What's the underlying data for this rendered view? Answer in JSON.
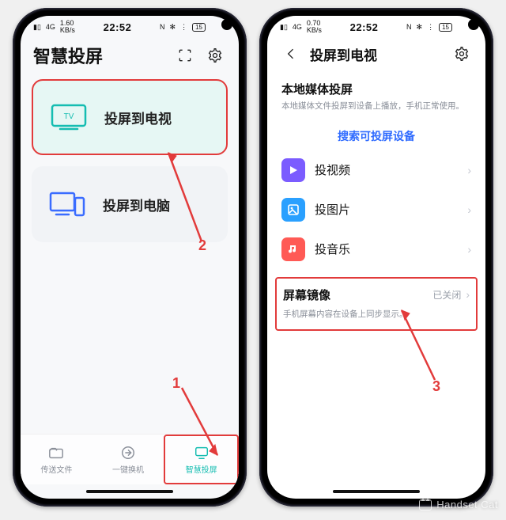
{
  "status": {
    "signal_label": "4G",
    "net_speed": "1.60",
    "net_unit": "KB/s",
    "net_speed2": "0.70",
    "time": "22:52",
    "nfc": "N",
    "bt": "✻",
    "wifi": "⋮",
    "battery": "15"
  },
  "left": {
    "title": "智慧投屏",
    "cast_tv": "投屏到电视",
    "cast_pc": "投屏到电脑",
    "nav": {
      "files": "传送文件",
      "onekey": "一键换机",
      "cast": "智慧投屏"
    }
  },
  "right": {
    "title": "投屏到电视",
    "local_title": "本地媒体投屏",
    "local_sub": "本地媒体文件投屏到设备上播放，手机正常使用。",
    "search": "搜索可投屏设备",
    "items": {
      "video": "投视频",
      "image": "投图片",
      "music": "投音乐"
    },
    "mirror_title": "屏幕镜像",
    "mirror_state": "已关闭",
    "mirror_sub": "手机屏幕内容在设备上同步显示。"
  },
  "annotations": {
    "n1": "1",
    "n2": "2",
    "n3": "3"
  },
  "watermark": "Handset Cat"
}
